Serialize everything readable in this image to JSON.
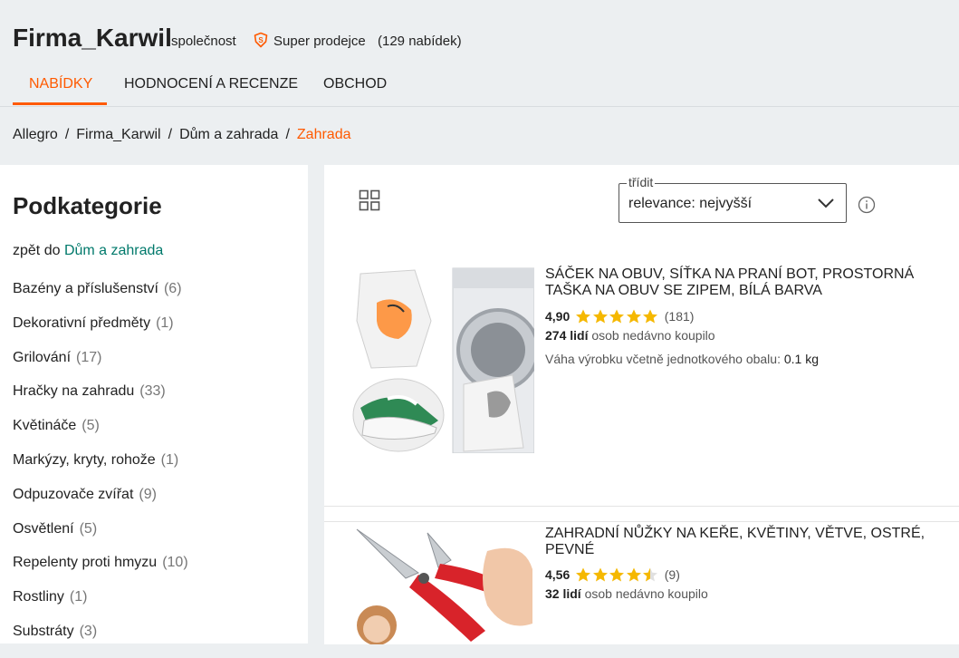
{
  "header": {
    "seller_name": "Firma_Karwil",
    "seller_type": "společnost",
    "super_seller_label": "Super prodejce",
    "offers_count": "(129 nabídek)",
    "super_icon": "super-seller-shield-icon",
    "tabs": [
      {
        "label": "NABÍDKY",
        "active": true
      },
      {
        "label": "HODNOCENÍ A RECENZE",
        "active": false
      },
      {
        "label": "OBCHOD",
        "active": false
      }
    ]
  },
  "breadcrumb": [
    "Allegro",
    "Firma_Karwil",
    "Dům a zahrada",
    "Zahrada"
  ],
  "sidebar": {
    "title": "Podkategorie",
    "back_prefix": "zpět do",
    "back_link": "Dům a zahrada",
    "categories": [
      {
        "label": "Bazény a příslušenství",
        "count": "(6)"
      },
      {
        "label": "Dekorativní předměty",
        "count": "(1)"
      },
      {
        "label": "Grilování",
        "count": "(17)"
      },
      {
        "label": "Hračky na zahradu",
        "count": "(33)"
      },
      {
        "label": "Květináče",
        "count": "(5)"
      },
      {
        "label": "Markýzy, kryty, rohože",
        "count": "(1)"
      },
      {
        "label": "Odpuzovače zvířat",
        "count": "(9)"
      },
      {
        "label": "Osvětlení",
        "count": "(5)"
      },
      {
        "label": "Repelenty proti hmyzu",
        "count": "(10)"
      },
      {
        "label": "Rostliny",
        "count": "(1)"
      },
      {
        "label": "Substráty",
        "count": "(3)"
      }
    ]
  },
  "toolbar": {
    "view_icon": "grid-view-icon",
    "sort_label": "třídit",
    "sort_value": "relevance: nejvyšší",
    "info_icon": "info-icon"
  },
  "products": [
    {
      "title": "SÁČEK NA OBUV, SÍŤKA NA PRANÍ BOT, PROSTORNÁ TAŠKA NA OBUV SE ZIPEM, BÍLÁ BARVA",
      "rating": "4,90",
      "stars": 5,
      "reviews": "(181)",
      "bought_count": "274 lidí",
      "bought_text": "osob nedávno koupilo",
      "weight_label": "Váha výrobku včetně jednotkového obalu:",
      "weight_value": "0.1 kg"
    },
    {
      "title": "ZAHRADNÍ NŮŽKY NA KEŘE, KVĚTINY, VĚTVE, OSTRÉ, PEVNÉ",
      "rating": "4,56",
      "stars": 4.5,
      "reviews": "(9)",
      "bought_count": "32 lidí",
      "bought_text": "osob nedávno koupilo"
    }
  ],
  "colors": {
    "accent": "#ff5a00",
    "link": "#00796b",
    "star": "#f5b800"
  }
}
